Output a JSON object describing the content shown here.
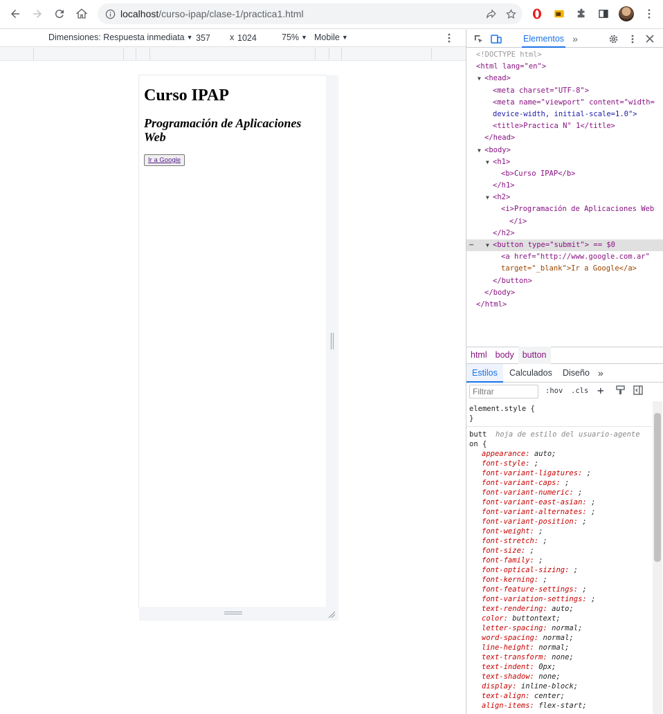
{
  "browser": {
    "url_host": "localhost",
    "url_path": "/curso-ipap/clase-1/practica1.html"
  },
  "device_toolbar": {
    "dimensions_label": "Dimensiones: Respuesta inmediata",
    "width": "357",
    "times": "x",
    "height": "1024",
    "zoom": "75%",
    "throttle": "Mobile"
  },
  "page": {
    "h1": "Curso IPAP",
    "h2": "Programación de Aplicaciones Web",
    "button_link": "Ir a Google"
  },
  "devtools": {
    "tab_elements": "Elementos",
    "dom_lines": [
      "<!DOCTYPE html>",
      "<html lang=\"en\">",
      "<head>",
      "<meta charset=\"UTF-8\">",
      "<meta name=\"viewport\" content=\"width=",
      "device-width, initial-scale=1.0\">",
      "<title>Practica N° 1</title>",
      "</head>",
      "<body>",
      "<h1>",
      "<b>Curso IPAP</b>",
      "</h1>",
      "<h2>",
      "<i>Programación de Aplicaciones Web",
      "</i>",
      "</h2>",
      "<button type=\"submit\"> == $0",
      "<a href=\"http://www.google.com.ar\"",
      "target=\"_blank\">Ir a Google</a>",
      "</button>",
      "</body>",
      "</html>"
    ],
    "breadcrumbs": [
      "html",
      "body",
      "button"
    ],
    "style_tabs": [
      "Estilos",
      "Calculados",
      "Diseño"
    ],
    "filter_placeholder": "Filtrar",
    "hov": ":hov",
    "cls": ".cls",
    "element_style": "element.style {",
    "close_brace": "}",
    "ua_selector_1": "butt",
    "ua_selector_2": "on {",
    "ua_source": "hoja de estilo del usuario-agente",
    "ua_props": [
      [
        "appearance",
        "auto;"
      ],
      [
        "font-style",
        ";"
      ],
      [
        "font-variant-ligatures",
        ";"
      ],
      [
        "font-variant-caps",
        ";"
      ],
      [
        "font-variant-numeric",
        ";"
      ],
      [
        "font-variant-east-asian",
        ";"
      ],
      [
        "font-variant-alternates",
        ";"
      ],
      [
        "font-variant-position",
        ";"
      ],
      [
        "font-weight",
        ";"
      ],
      [
        "font-stretch",
        ";"
      ],
      [
        "font-size",
        ";"
      ],
      [
        "font-family",
        ";"
      ],
      [
        "font-optical-sizing",
        ";"
      ],
      [
        "font-kerning",
        ";"
      ],
      [
        "font-feature-settings",
        ";"
      ],
      [
        "font-variation-settings",
        ";"
      ],
      [
        "text-rendering",
        "auto;"
      ],
      [
        "color",
        "buttontext;"
      ],
      [
        "letter-spacing",
        "normal;"
      ],
      [
        "word-spacing",
        "normal;"
      ],
      [
        "line-height",
        "normal;"
      ],
      [
        "text-transform",
        "none;"
      ],
      [
        "text-indent",
        "0px;"
      ],
      [
        "text-shadow",
        "none;"
      ],
      [
        "display",
        "inline-block;"
      ],
      [
        "text-align",
        "center;"
      ],
      [
        "align-items",
        "flex-start;"
      ]
    ]
  },
  "colors": {
    "accent": "#1a73e8",
    "tag": "#881280",
    "attr": "#994500",
    "value": "#1a1aa6",
    "css_prop": "#c80000"
  }
}
